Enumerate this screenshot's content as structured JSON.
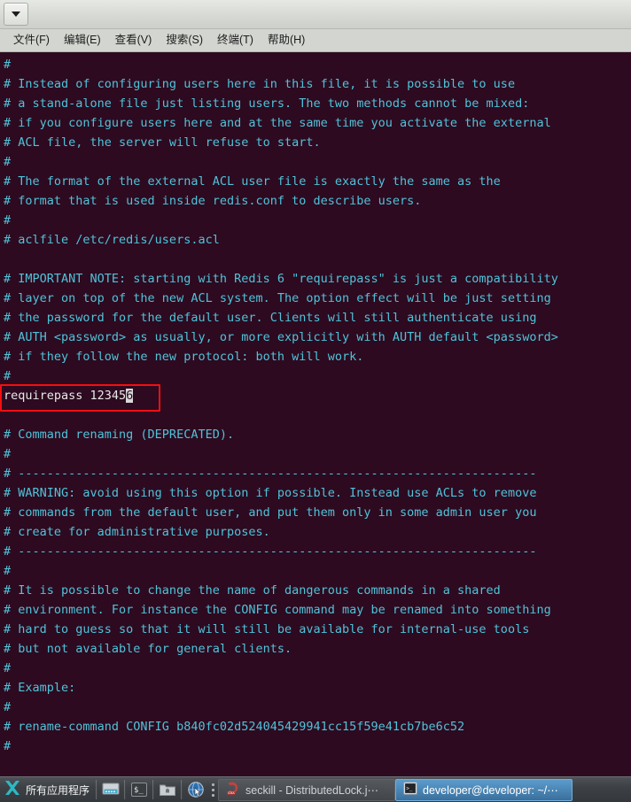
{
  "window": {
    "tablist_button_icon": "chevron-down-icon",
    "menus": [
      {
        "label": "文件(F)"
      },
      {
        "label": "编辑(E)"
      },
      {
        "label": "查看(V)"
      },
      {
        "label": "搜索(S)"
      },
      {
        "label": "终端(T)"
      },
      {
        "label": "帮助(H)"
      }
    ]
  },
  "terminal": {
    "background_color": "#2d0a20",
    "text_color": "#4fc3d9",
    "config_line_color": "#e8e8e8",
    "annotation_color": "#f40f10",
    "lines": [
      {
        "text": "#",
        "kind": "comment"
      },
      {
        "text": "# Instead of configuring users here in this file, it is possible to use",
        "kind": "comment"
      },
      {
        "text": "# a stand-alone file just listing users. The two methods cannot be mixed:",
        "kind": "comment"
      },
      {
        "text": "# if you configure users here and at the same time you activate the external",
        "kind": "comment"
      },
      {
        "text": "# ACL file, the server will refuse to start.",
        "kind": "comment"
      },
      {
        "text": "#",
        "kind": "comment"
      },
      {
        "text": "# The format of the external ACL user file is exactly the same as the",
        "kind": "comment"
      },
      {
        "text": "# format that is used inside redis.conf to describe users.",
        "kind": "comment"
      },
      {
        "text": "#",
        "kind": "comment"
      },
      {
        "text": "# aclfile /etc/redis/users.acl",
        "kind": "comment"
      },
      {
        "text": "",
        "kind": "comment"
      },
      {
        "text": "# IMPORTANT NOTE: starting with Redis 6 \"requirepass\" is just a compatibility",
        "kind": "comment"
      },
      {
        "text": "# layer on top of the new ACL system. The option effect will be just setting",
        "kind": "comment"
      },
      {
        "text": "# the password for the default user. Clients will still authenticate using",
        "kind": "comment"
      },
      {
        "text": "# AUTH <password> as usually, or more explicitly with AUTH default <password>",
        "kind": "comment"
      },
      {
        "text": "# if they follow the new protocol: both will work.",
        "kind": "comment"
      },
      {
        "text": "#",
        "kind": "comment"
      },
      {
        "text": "requirepass 12345",
        "kind": "config",
        "cursor_char": "6"
      },
      {
        "text": "",
        "kind": "comment"
      },
      {
        "text": "# Command renaming (DEPRECATED).",
        "kind": "comment"
      },
      {
        "text": "#",
        "kind": "comment"
      },
      {
        "text": "# ------------------------------------------------------------------------",
        "kind": "comment"
      },
      {
        "text": "# WARNING: avoid using this option if possible. Instead use ACLs to remove",
        "kind": "comment"
      },
      {
        "text": "# commands from the default user, and put them only in some admin user you",
        "kind": "comment"
      },
      {
        "text": "# create for administrative purposes.",
        "kind": "comment"
      },
      {
        "text": "# ------------------------------------------------------------------------",
        "kind": "comment"
      },
      {
        "text": "#",
        "kind": "comment"
      },
      {
        "text": "# It is possible to change the name of dangerous commands in a shared",
        "kind": "comment"
      },
      {
        "text": "# environment. For instance the CONFIG command may be renamed into something",
        "kind": "comment"
      },
      {
        "text": "# hard to guess so that it will still be available for internal-use tools",
        "kind": "comment"
      },
      {
        "text": "# but not available for general clients.",
        "kind": "comment"
      },
      {
        "text": "#",
        "kind": "comment"
      },
      {
        "text": "# Example:",
        "kind": "comment"
      },
      {
        "text": "#",
        "kind": "comment"
      },
      {
        "text": "# rename-command CONFIG b840fc02d524045429941cc15f59e41cb7be6c52",
        "kind": "comment"
      },
      {
        "text": "#",
        "kind": "comment"
      }
    ]
  },
  "taskbar": {
    "start_label": "所有应用程序",
    "launchers": [
      {
        "name": "show-desktop-icon"
      },
      {
        "name": "terminal-icon"
      },
      {
        "name": "file-manager-icon"
      },
      {
        "name": "web-browser-icon"
      }
    ],
    "windows": [
      {
        "label": "seckill - DistributedLock.j⋯",
        "icon": "intellij-idea-icon",
        "active": false
      },
      {
        "label": "developer@developer: ~/⋯",
        "icon": "terminal-icon",
        "active": true
      }
    ]
  }
}
